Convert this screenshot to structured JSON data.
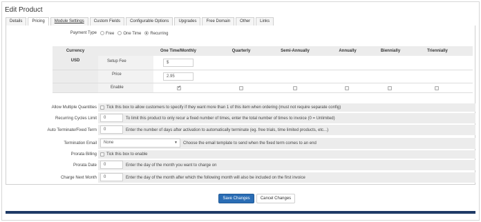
{
  "page": {
    "title": "Edit Product"
  },
  "tabs": [
    {
      "label": "Details"
    },
    {
      "label": "Pricing",
      "active": true
    },
    {
      "label": "Module Settings"
    },
    {
      "label": "Custom Fields"
    },
    {
      "label": "Configurable Options"
    },
    {
      "label": "Upgrades"
    },
    {
      "label": "Free Domain"
    },
    {
      "label": "Other"
    },
    {
      "label": "Links"
    }
  ],
  "payment_type": {
    "label": "Payment Type",
    "options": [
      "Free",
      "One Time",
      "Recurring"
    ],
    "selected": "Recurring"
  },
  "pricing": {
    "currency_header": "Currency",
    "currency": "USD",
    "columns": [
      "One Time/Monthly",
      "Quarterly",
      "Semi-Annually",
      "Annually",
      "Biennially",
      "Triennially"
    ],
    "setup_fee_label": "Setup Fee",
    "setup_fee_value": "$",
    "price_label": "Price",
    "price_value": "2.95",
    "enable_label": "Enable",
    "enabled": [
      true,
      false,
      false,
      false,
      false,
      false
    ]
  },
  "fields": {
    "allow_multiple": {
      "label": "Allow Multiple Quantities",
      "text": "Tick this box to allow customers to specify if they want more than 1 of this item when ordering (must not require separate config)"
    },
    "recurring_limit": {
      "label": "Recurring Cycles Limit",
      "value": "0",
      "text": "To limit this product to only recur a fixed number of times, enter the total number of times to invoice (0 = Unlimited)"
    },
    "auto_terminate": {
      "label": "Auto Terminate/Fixed Term",
      "value": "0",
      "text": "Enter the number of days after activation to automatically terminate (eg. free trials, time limited products, etc...)"
    },
    "termination_email": {
      "label": "Termination Email",
      "value": "None",
      "text": "Choose the email template to send when the fixed term comes to an end"
    },
    "prorata_billing": {
      "label": "Prorata Billing",
      "text": "Tick this box to enable"
    },
    "prorata_date": {
      "label": "Prorata Date",
      "value": "0",
      "text": "Enter the day of the month you want to charge on"
    },
    "charge_next_month": {
      "label": "Charge Next Month",
      "value": "0",
      "text": "Enter the day of the month after which the following month will also be included on the first invoice"
    }
  },
  "actions": {
    "save": "Save Changes",
    "cancel": "Cancel Changes"
  }
}
